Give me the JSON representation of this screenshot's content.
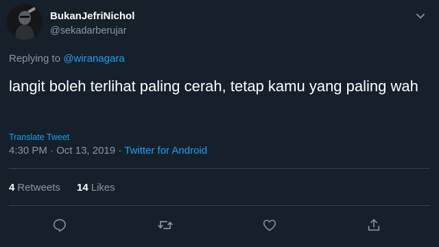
{
  "user": {
    "display_name": "BukanJefriNichol",
    "handle": "@sekadarberujar"
  },
  "reply": {
    "prefix": "Replying to",
    "mention": "@wiranagara"
  },
  "tweet": {
    "text": "langit boleh terlihat paling cerah, tetap kamu yang paling wah",
    "translate_label": "Translate Tweet",
    "time": "4:30 PM",
    "separator": "·",
    "date": "Oct 13, 2019",
    "client": "Twitter for Android"
  },
  "stats": {
    "retweets_count": "4",
    "retweets_label": "Retweets",
    "likes_count": "14",
    "likes_label": "Likes"
  },
  "actions": {
    "icons": [
      "reply-icon",
      "retweet-icon",
      "like-icon",
      "share-icon"
    ]
  },
  "colors": {
    "background": "#15202b",
    "accent": "#1da1f2",
    "secondary_text": "#8899a6",
    "divider": "#38444d"
  }
}
